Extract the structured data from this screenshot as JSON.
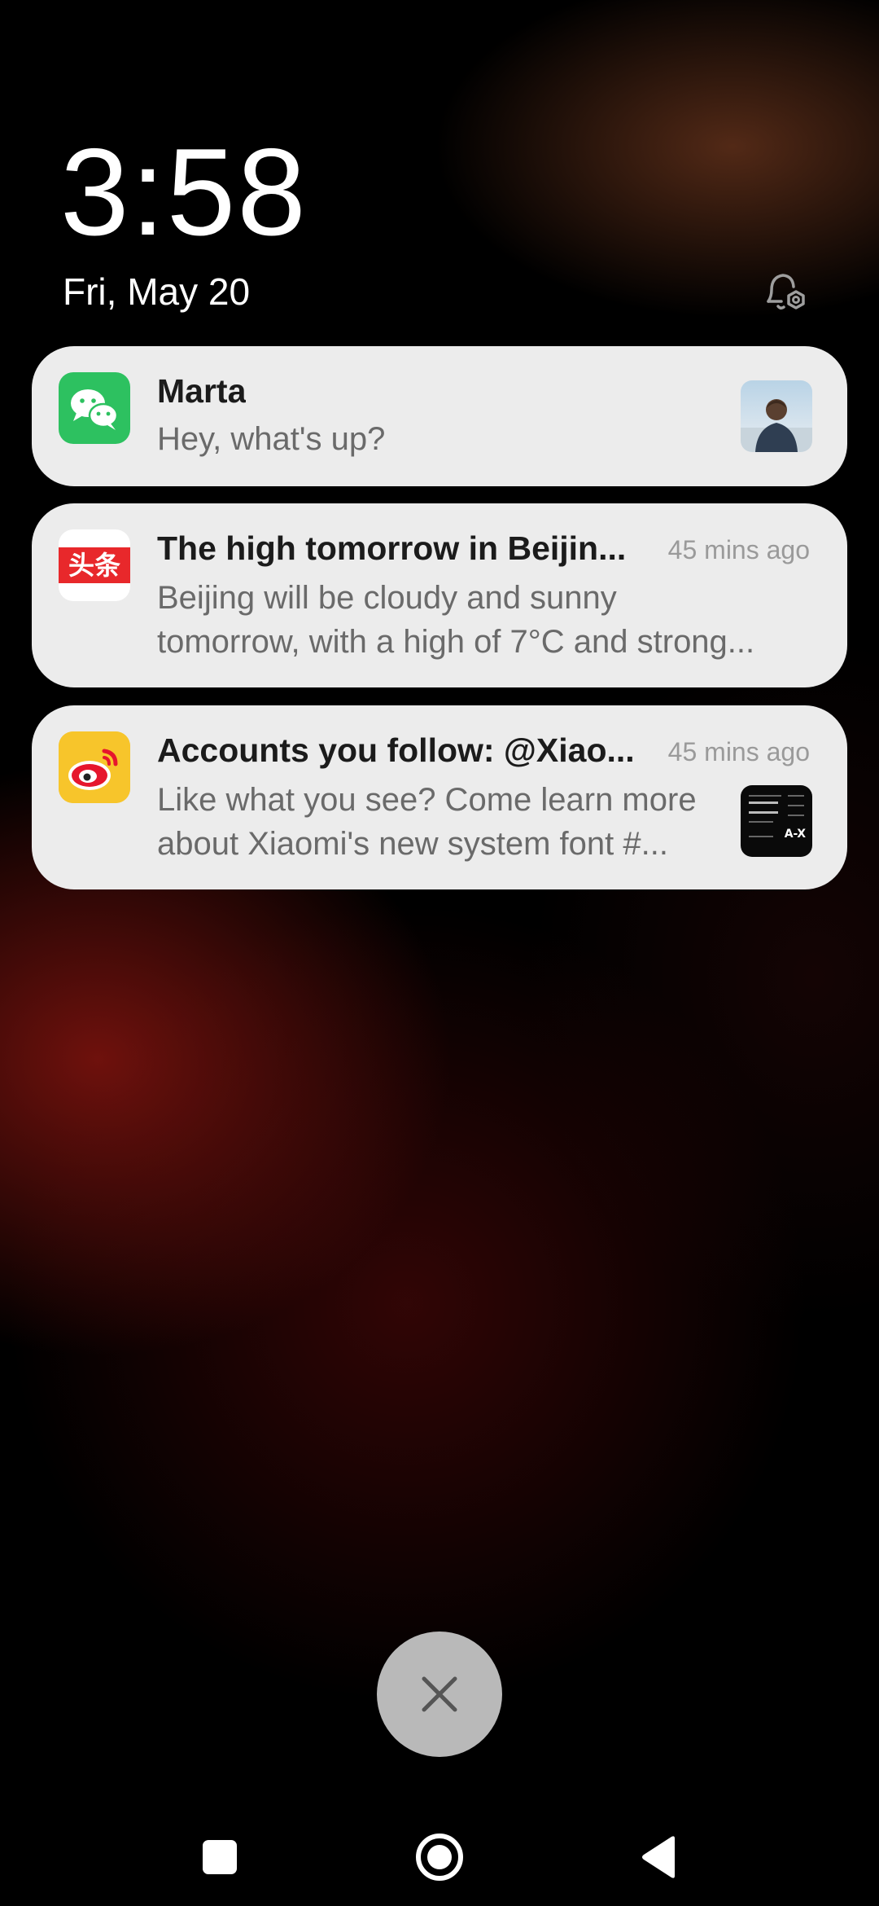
{
  "lockscreen": {
    "time": "3:58",
    "date": "Fri,  May 20"
  },
  "notifications": [
    {
      "app_icon": "wechat-icon",
      "title": "Marta",
      "time": "",
      "body_line1": "Hey, what's up?",
      "body_line2": "",
      "has_thumbnail": true,
      "thumbnail": "person-photo"
    },
    {
      "app_icon": "toutiao-icon",
      "app_icon_text": "头条",
      "title": "The high tomorrow in Beijin...",
      "time": "45 mins ago",
      "body_line1": "Beijing will be cloudy and sunny",
      "body_line2": "tomorrow, with a high of 7°C and strong...",
      "has_thumbnail": false
    },
    {
      "app_icon": "weibo-icon",
      "title": "Accounts you follow: @Xiao...",
      "time": "45 mins ago",
      "body_line1": "Like what you see? Come learn more",
      "body_line2": "about Xiaomi's new system font #...",
      "has_thumbnail": true,
      "thumbnail": "font-preview-image",
      "thumbnail_text": "A-X"
    }
  ],
  "colors": {
    "card_bg": "#ececec",
    "wechat_green": "#2dc160",
    "toutiao_red": "#e8282b",
    "weibo_yellow": "#f7c52b",
    "dismiss_bg": "#b9b9b9"
  }
}
